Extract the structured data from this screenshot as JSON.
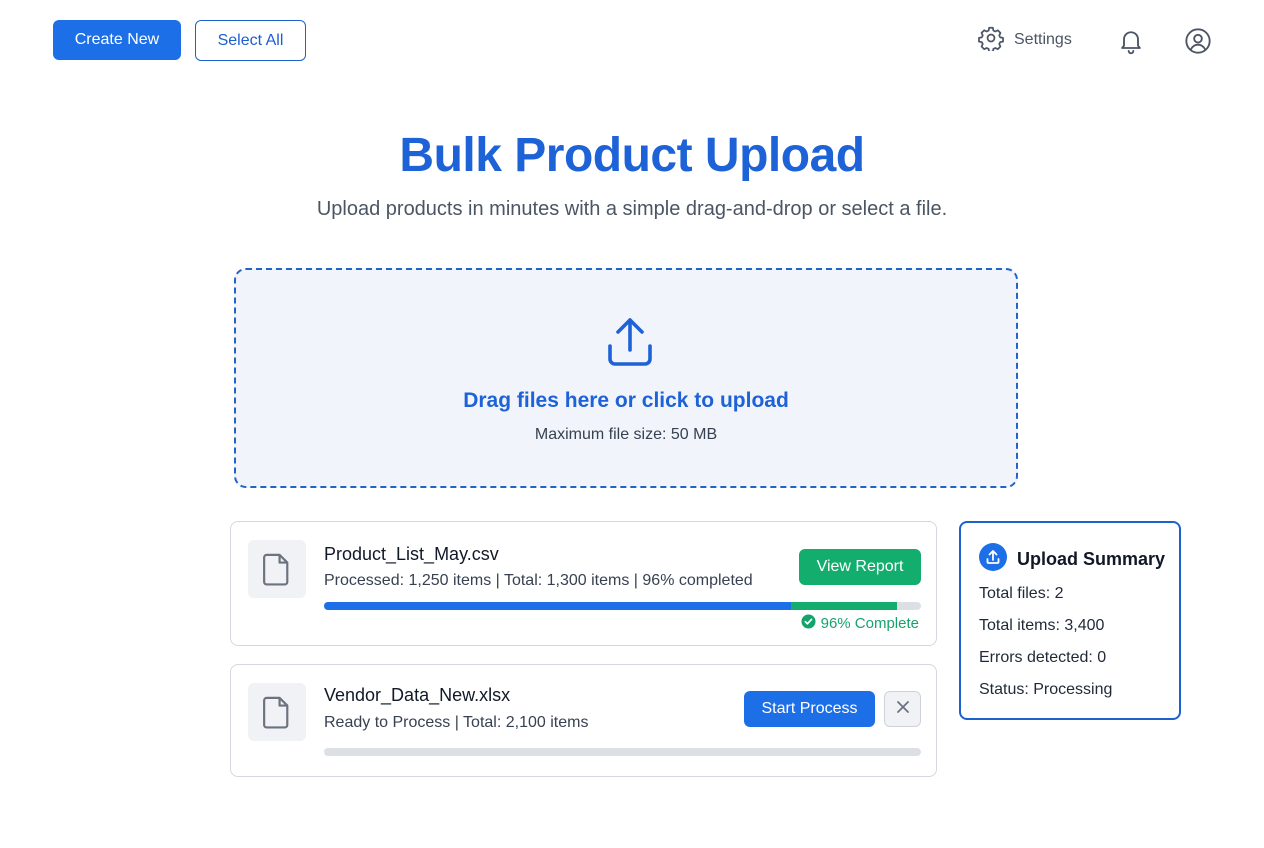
{
  "toolbar": {
    "create_new_label": "Create New",
    "select_all_label": "Select All",
    "settings_label": "Settings"
  },
  "header": {
    "title": "Bulk Product Upload",
    "subtitle": "Upload products in minutes with a simple drag-and-drop or select a file."
  },
  "dropzone": {
    "prompt": "Drag files here or click to upload",
    "max_size": "Maximum file size: 50 MB",
    "icon": "upload-icon"
  },
  "files": [
    {
      "name": "Product_List_May.csv",
      "meta": "Processed: 1,250 items | Total: 1,300 items | 96% completed",
      "progress": 0.96,
      "action_label": "View Report",
      "status_label": "96% Complete",
      "icon": "document-icon"
    },
    {
      "name": "Vendor_Data_New.xlsx",
      "meta": "Ready to Process | Total: 2,100 items",
      "progress": 0,
      "action_label": "Start Process",
      "icon": "document-icon"
    }
  ],
  "summary": {
    "title": "Upload Summary",
    "total_files": "Total files: 2",
    "total_items": "Total items: 3,400",
    "errors": "Errors detected: 0",
    "status": "Status: Processing"
  },
  "colors": {
    "primary": "#1d6fe8",
    "title_blue": "#1d62d6",
    "success": "#13ad6e",
    "progress_blue": "#1d6fe8",
    "progress_green": "#13ad6e"
  }
}
